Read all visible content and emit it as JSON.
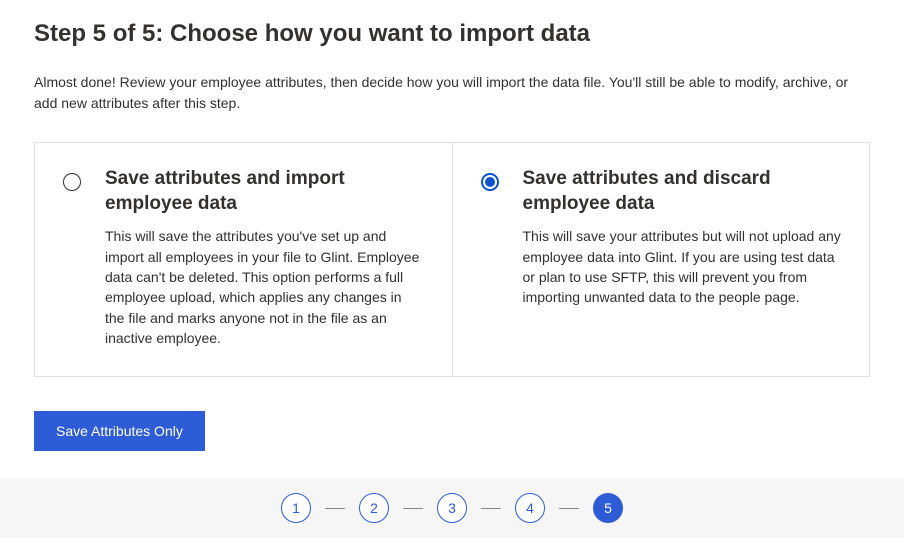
{
  "page": {
    "title": "Step 5 of 5: Choose how you want to import data",
    "intro": "Almost done! Review your employee attributes, then decide how you will import the data file. You'll still be able to modify, archive, or add new attributes after this step."
  },
  "options": [
    {
      "title": "Save attributes and import employee data",
      "description": "This will save the attributes you've set up and import all employees in your file to Glint. Employee data can't be deleted. This option performs a full employee upload, which applies any changes in the file and marks anyone not in the file as an inactive employee.",
      "selected": false
    },
    {
      "title": "Save attributes and discard employee data",
      "description": "This will save your attributes but will not upload any employee data into Glint. If you are using test data or plan to use SFTP, this will prevent you from importing unwanted data to the people page.",
      "selected": true
    }
  ],
  "actions": {
    "primary_label": "Save Attributes Only"
  },
  "stepper": {
    "steps": [
      "1",
      "2",
      "3",
      "4",
      "5"
    ],
    "active_index": 4
  },
  "colors": {
    "primary": "#2e5cd6",
    "step_bg": "#f6f6f6"
  }
}
